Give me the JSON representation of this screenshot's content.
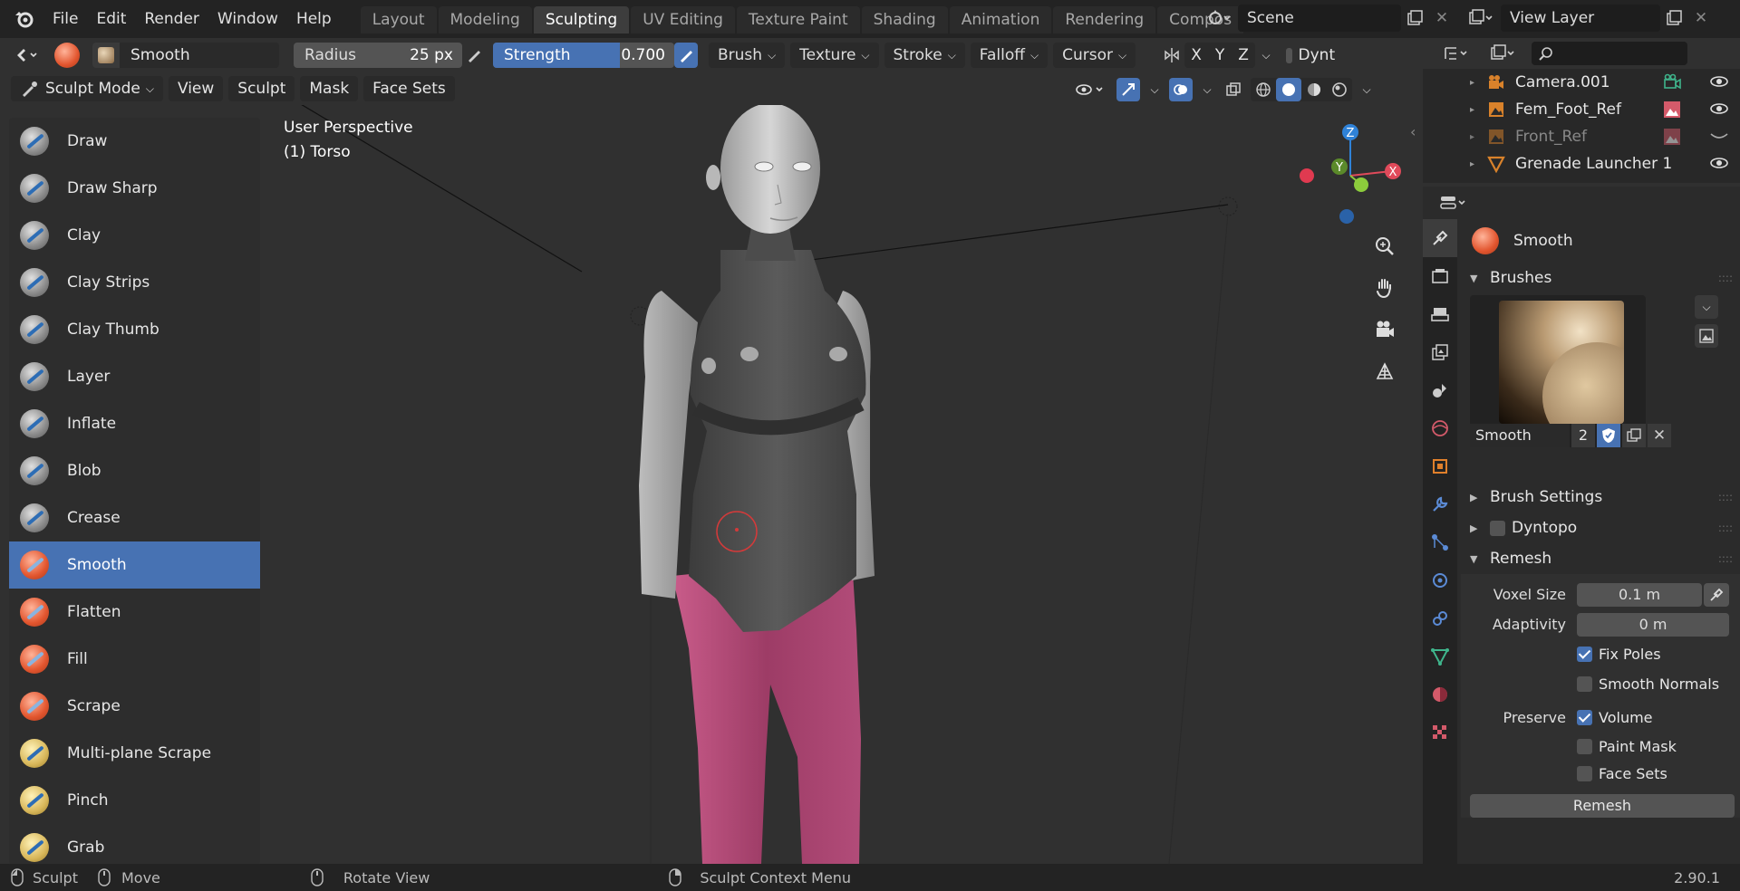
{
  "menu": {
    "items": [
      "File",
      "Edit",
      "Render",
      "Window",
      "Help"
    ]
  },
  "workspaces": {
    "tabs": [
      "Layout",
      "Modeling",
      "Sculpting",
      "UV Editing",
      "Texture Paint",
      "Shading",
      "Animation",
      "Rendering",
      "Compos"
    ],
    "active": "Sculpting"
  },
  "scene": {
    "name": "Scene",
    "view_layer": "View Layer"
  },
  "tool_header": {
    "brush_name": "Smooth",
    "radius_label": "Radius",
    "radius_value": "25 px",
    "strength_label": "Strength",
    "strength_value": "0.700",
    "strength_fraction": 0.7,
    "menus": [
      "Brush",
      "Texture",
      "Stroke",
      "Falloff",
      "Cursor"
    ],
    "axes": [
      "X",
      "Y",
      "Z"
    ],
    "dyntopo_label": "Dynt"
  },
  "mode_header": {
    "mode": "Sculpt Mode",
    "menus": [
      "View",
      "Sculpt",
      "Mask",
      "Face Sets"
    ]
  },
  "viewport": {
    "perspective": "User Perspective",
    "object": "(1) Torso",
    "gizmo_axes": {
      "z": "Z",
      "y": "Y",
      "x": "X"
    }
  },
  "toolbar": {
    "tools": [
      {
        "label": "Draw",
        "style": "blue"
      },
      {
        "label": "Draw Sharp",
        "style": "blue"
      },
      {
        "label": "Clay",
        "style": "blue"
      },
      {
        "label": "Clay Strips",
        "style": "blue"
      },
      {
        "label": "Clay Thumb",
        "style": "blue"
      },
      {
        "label": "Layer",
        "style": "blue"
      },
      {
        "label": "Inflate",
        "style": "blue"
      },
      {
        "label": "Blob",
        "style": "blue"
      },
      {
        "label": "Crease",
        "style": "blue"
      },
      {
        "label": "Smooth",
        "style": "orange"
      },
      {
        "label": "Flatten",
        "style": "orange"
      },
      {
        "label": "Fill",
        "style": "orange"
      },
      {
        "label": "Scrape",
        "style": "orange"
      },
      {
        "label": "Multi-plane Scrape",
        "style": "yellow"
      },
      {
        "label": "Pinch",
        "style": "yellow"
      },
      {
        "label": "Grab",
        "style": "yellow"
      }
    ],
    "active_index": 9
  },
  "outliner": {
    "items": [
      {
        "label": "Camera.001",
        "icon": "camera-icon",
        "dim": false
      },
      {
        "label": "Fem_Foot_Ref",
        "icon": "image-icon",
        "dim": false
      },
      {
        "label": "Front_Ref",
        "icon": "image-icon",
        "dim": true
      },
      {
        "label": "Grenade Launcher 1",
        "icon": "mesh-icon",
        "dim": false
      }
    ]
  },
  "properties": {
    "brush_title": "Smooth",
    "brushes_panel": "Brushes",
    "brush_datablock": "Smooth",
    "brush_users": "2",
    "brush_settings": "Brush Settings",
    "dyntopo": "Dyntopo",
    "remesh": "Remesh",
    "voxel_size_label": "Voxel Size",
    "voxel_size_value": "0.1 m",
    "adaptivity_label": "Adaptivity",
    "adaptivity_value": "0 m",
    "fix_poles": "Fix Poles",
    "smooth_normals": "Smooth Normals",
    "preserve_label": "Preserve",
    "volume": "Volume",
    "paint_mask": "Paint Mask",
    "face_sets": "Face Sets",
    "remesh_button": "Remesh"
  },
  "statusbar": {
    "sculpt": "Sculpt",
    "move": "Move",
    "rotate": "Rotate View",
    "context": "Sculpt Context Menu",
    "version": "2.90.1"
  },
  "colors": {
    "accent": "#4772b3",
    "pants": "#b84f7a",
    "shirt": "#4a4a4a",
    "skin": "#c9c9c9"
  }
}
